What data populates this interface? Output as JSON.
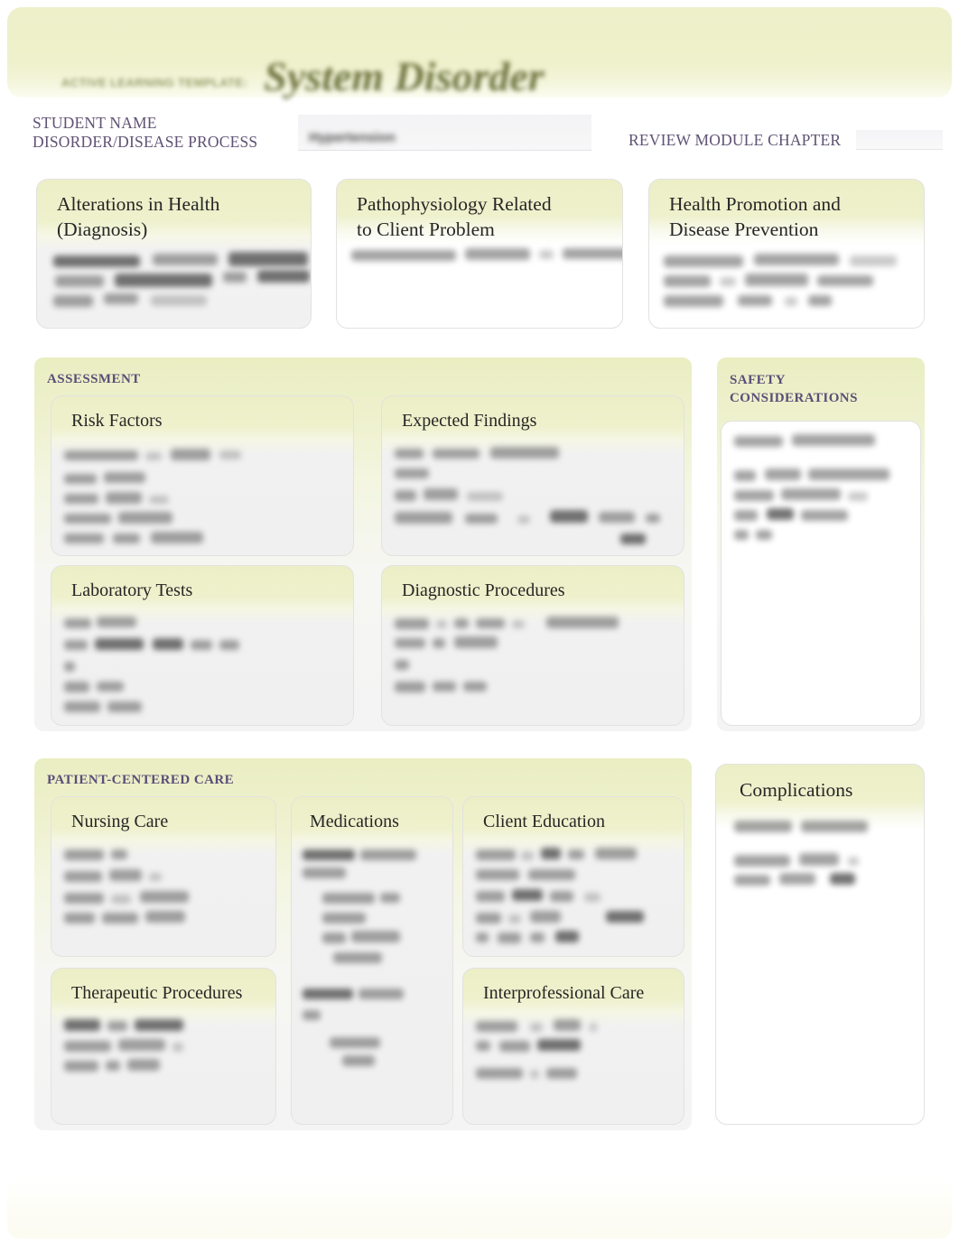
{
  "document": {
    "kicker": "ACTIVE LEARNING TEMPLATE:",
    "title": "System Disorder",
    "type": "ATI Active Learning Template"
  },
  "meta": {
    "student_name_label": "STUDENT NAME",
    "disorder_label": "DISORDER/DISEASE PROCESS",
    "disorder_value": "Hypertension",
    "review_module_label": "REVIEW MODULE CHAPTER",
    "review_module_value": ""
  },
  "top_row": {
    "alterations": {
      "title": "Alterations in Health\n(Diagnosis)"
    },
    "pathophysiology": {
      "title": "Pathophysiology Related\nto Client Problem"
    },
    "health_promotion": {
      "title": "Health Promotion and\nDisease Prevention"
    }
  },
  "assessment": {
    "section_label": "ASSESSMENT",
    "cards": {
      "risk_factors": {
        "title": "Risk Factors"
      },
      "expected_findings": {
        "title": "Expected Findings"
      },
      "laboratory_tests": {
        "title": "Laboratory Tests"
      },
      "diagnostic_procedures": {
        "title": "Diagnostic Procedures"
      }
    }
  },
  "safety": {
    "section_label": "SAFETY\nCONSIDERATIONS"
  },
  "patient_centered_care": {
    "section_label": "PATIENT-CENTERED CARE",
    "cards": {
      "nursing_care": {
        "title": "Nursing Care"
      },
      "medications": {
        "title": "Medications"
      },
      "client_education": {
        "title": "Client Education"
      },
      "therapeutic_procedures": {
        "title": "Therapeutic Procedures"
      },
      "interprofessional_care": {
        "title": "Interprofessional Care"
      }
    }
  },
  "complications": {
    "title": "Complications"
  },
  "colors": {
    "band": "#edf0c9",
    "card_header": "#ecefc6",
    "section_label": "#5b4d78",
    "meta_label": "#5f5274",
    "title_text": "#262626",
    "masthead_title": "#6e7440",
    "page": "#ffffff"
  }
}
